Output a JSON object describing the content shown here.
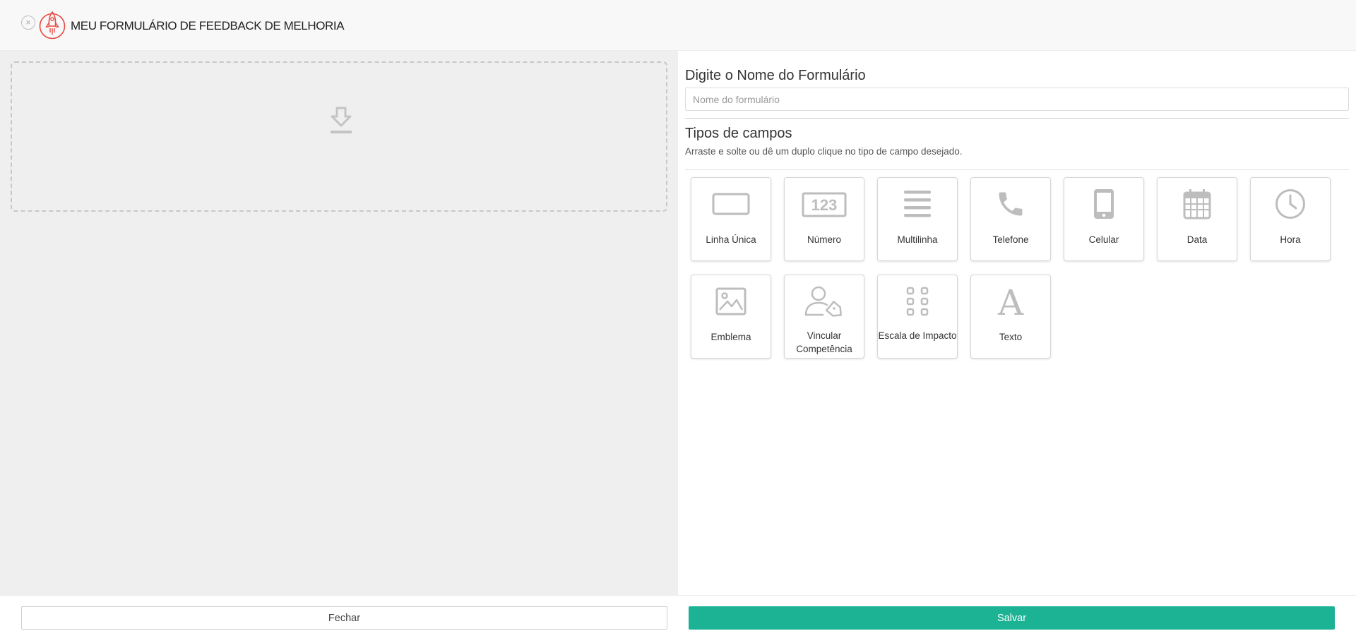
{
  "header": {
    "title": "MEU FORMULÁRIO DE FEEDBACK DE MELHORIA",
    "close_icon": "close-circle-icon",
    "logo_icon": "rocket-logo-icon",
    "logo_color": "#e84b45"
  },
  "dropzone": {
    "icon": "download-icon"
  },
  "form_name": {
    "label": "Digite o Nome do Formulário",
    "placeholder": "Nome do formulário",
    "value": ""
  },
  "field_types": {
    "title": "Tipos de campos",
    "hint": "Arraste e solte ou dê um duplo clique no tipo de campo desejado.",
    "items": [
      {
        "label": "Linha Única",
        "icon": "single-line-icon"
      },
      {
        "label": "Número",
        "icon": "number-icon"
      },
      {
        "label": "Multilinha",
        "icon": "multiline-icon"
      },
      {
        "label": "Telefone",
        "icon": "phone-icon"
      },
      {
        "label": "Celular",
        "icon": "mobile-icon"
      },
      {
        "label": "Data",
        "icon": "calendar-icon"
      },
      {
        "label": "Hora",
        "icon": "clock-icon"
      },
      {
        "label": "Emblema",
        "icon": "image-icon"
      },
      {
        "label": "Vincular Competência",
        "icon": "user-tag-icon"
      },
      {
        "label": "Escala de Impacto",
        "icon": "grid-dots-icon"
      },
      {
        "label": "Texto",
        "icon": "text-icon"
      }
    ],
    "number_icon_text": "123",
    "text_icon_glyph": "A"
  },
  "footer": {
    "close_label": "Fechar",
    "save_label": "Salvar",
    "save_color": "#1bb394"
  }
}
